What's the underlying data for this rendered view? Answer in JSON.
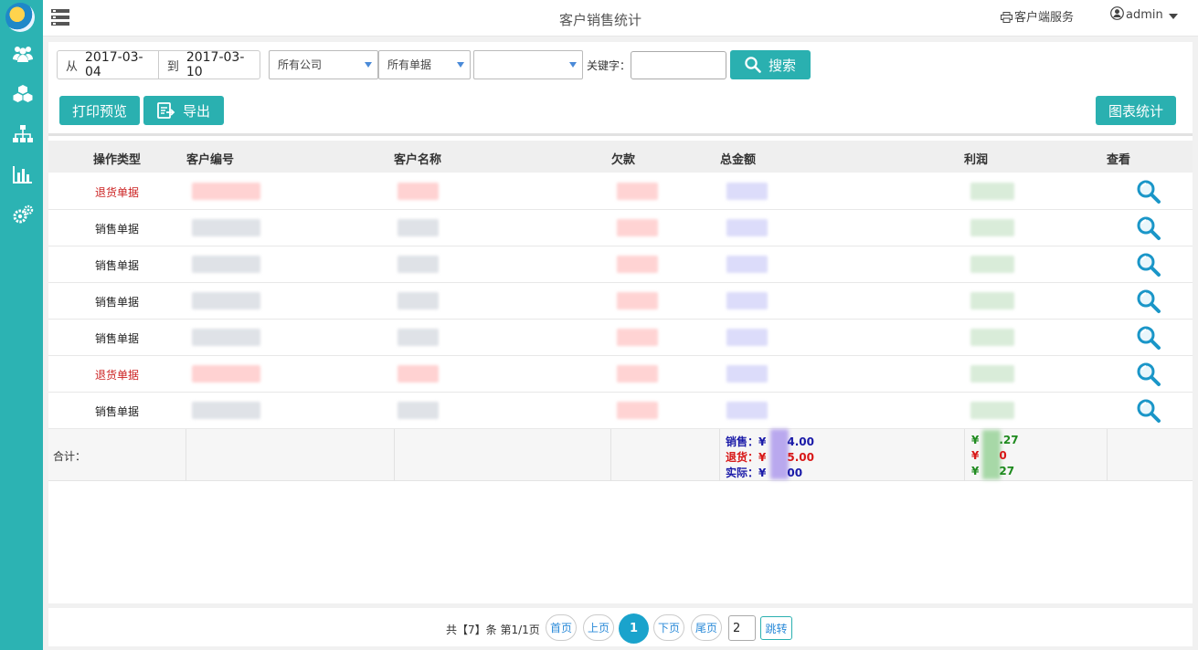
{
  "header": {
    "title": "客户销售统计",
    "client_service": "客户端服务",
    "user": "admin"
  },
  "sidebar": {
    "items": [
      {
        "icon": "users-icon"
      },
      {
        "icon": "cubes-icon"
      },
      {
        "icon": "sitemap-icon"
      },
      {
        "icon": "bar-chart-icon"
      },
      {
        "icon": "gears-icon"
      }
    ]
  },
  "filters": {
    "from_label": "从",
    "from_date": "2017-03-04",
    "to_label": "到",
    "to_date": "2017-03-10",
    "company_select": "所有公司",
    "doc_select": "所有单据",
    "third_select": "",
    "keyword_label": "关键字：",
    "keyword_value": "",
    "search_label": "搜索"
  },
  "toolbar": {
    "print_preview": "打印预览",
    "export": "导出",
    "chart_stats": "图表统计"
  },
  "table": {
    "columns": [
      "操作类型",
      "客户编号",
      "客户名称",
      "欠款",
      "总金额",
      "利润",
      "查看"
    ],
    "rows": [
      {
        "type": "退货单据",
        "is_return": true
      },
      {
        "type": "销售单据",
        "is_return": false
      },
      {
        "type": "销售单据",
        "is_return": false
      },
      {
        "type": "销售单据",
        "is_return": false
      },
      {
        "type": "销售单据",
        "is_return": false
      },
      {
        "type": "退货单据",
        "is_return": true
      },
      {
        "type": "销售单据",
        "is_return": false
      }
    ],
    "total_label": "合计：",
    "sales_label": "销售：¥",
    "sales_tail": "4.00",
    "return_label": "退货：¥",
    "return_tail": "5.00",
    "actual_label": "实际：¥",
    "actual_tail": "00",
    "profit_sales_pre": "¥",
    "profit_sales_tail": ".27",
    "profit_return_pre": "¥",
    "profit_return_tail": "0",
    "profit_actual_pre": "¥",
    "profit_actual_tail": "27"
  },
  "pager": {
    "info": "共【7】条 第1/1页",
    "first": "首页",
    "prev": "上页",
    "current": "1",
    "next": "下页",
    "last": "尾页",
    "jump_value": "2",
    "jump": "跳转"
  },
  "colors": {
    "accent": "#2ab0b0",
    "return_text": "#cc2222",
    "sales_text": "#222222",
    "sum_blue": "#1a1aa8",
    "sum_red": "#d81818",
    "sum_green": "#1e8a1e"
  }
}
